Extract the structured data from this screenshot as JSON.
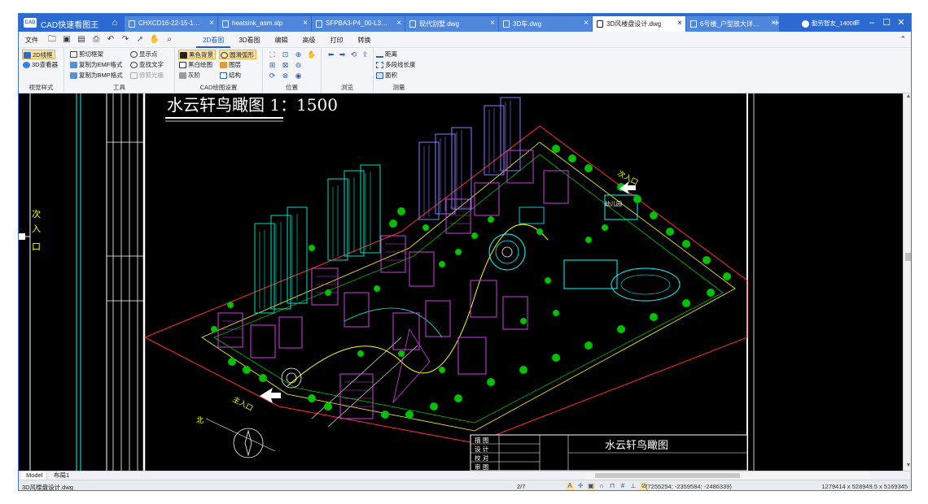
{
  "app": {
    "logo_text": "CAD",
    "title": "CAD快速看图王"
  },
  "tabs": [
    {
      "label": "CHXCD16-22-15-10-1..."
    },
    {
      "label": "heatsink_asm.stp"
    },
    {
      "label": "SFPBA3-P4_00-L3-B3J..."
    },
    {
      "label": "现代别墅.dwg"
    },
    {
      "label": "3D车.dwg"
    },
    {
      "label": "3D风楼盘设计.dwg"
    },
    {
      "label": "6号楼_户型放大详图_t8..."
    }
  ],
  "active_tab_index": 5,
  "user": {
    "name": "勤劳智友_14008"
  },
  "menu": {
    "file": "文件",
    "items": [
      "2D看图",
      "3D看图",
      "编辑",
      "高级",
      "打印",
      "转换"
    ],
    "active": "2D看图"
  },
  "ribbon": {
    "view_style": {
      "title": "视觉样式",
      "buttons": [
        "2D线框",
        "3D查看器"
      ]
    },
    "tools": {
      "title": "工具",
      "buttons": [
        "剪切框架",
        "复制为EMF格式",
        "复制为BMP格式",
        "显示点",
        "查找文字",
        "修剪光栅"
      ]
    },
    "cad_settings": {
      "title": "CAD绘图设置",
      "buttons": [
        "黑色背景",
        "黑白绘图",
        "灰阶",
        "圆滑弧形",
        "图层",
        "结构"
      ]
    },
    "position": {
      "title": "位置"
    },
    "browse": {
      "title": "浏览"
    },
    "measure": {
      "title": "测量",
      "buttons": [
        "距离",
        "多段线长度",
        "面积"
      ]
    }
  },
  "drawing": {
    "title": "水云轩鸟瞰图  1：1500",
    "side_label": "次入口",
    "main_entrance": "主入口",
    "secondary_entrance": "次入口",
    "kindergarten": "幼儿园",
    "title_block": {
      "rows": [
        "描 图",
        "设 计",
        "校 对",
        "审 图"
      ],
      "name": "水云轩鸟瞰图"
    }
  },
  "layout_tabs": [
    "Model",
    "布局1"
  ],
  "status": {
    "file": "3D风楼盘设计.dwg",
    "page": "2/7",
    "coords": "(7255254; -2359584; -2486339)",
    "size": "1279414 x 528949.5 x 5169345"
  },
  "colors": {
    "titlebar": "#2b6ad1",
    "cad_background": "#000000",
    "tower_cyan": "#00e0c0",
    "tower_blue": "#8080ff",
    "block_magenta": "#d040e0",
    "trees": "#00c000"
  }
}
